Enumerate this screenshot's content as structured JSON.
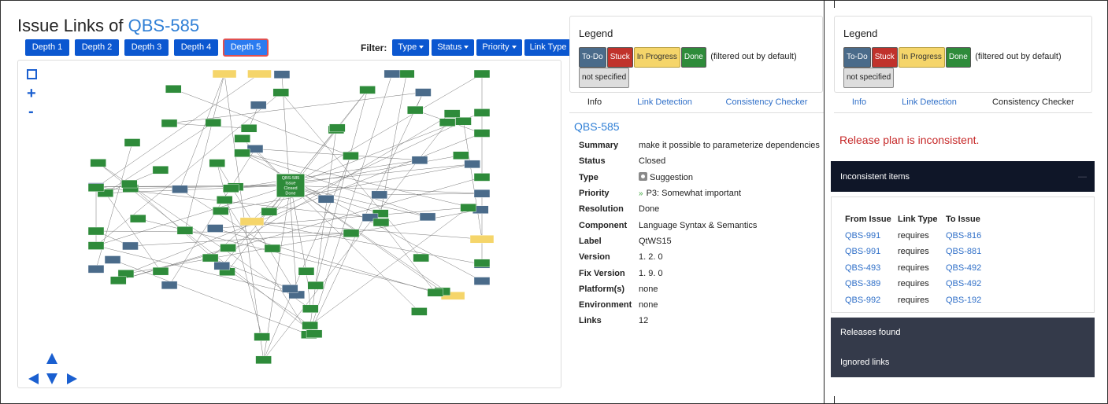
{
  "header": {
    "title_prefix": "Issue Links of ",
    "issue_key": "QBS-585"
  },
  "depth_buttons": [
    "Depth 1",
    "Depth 2",
    "Depth 3",
    "Depth 4",
    "Depth 5"
  ],
  "active_depth": "Depth 5",
  "filter": {
    "label": "Filter:",
    "buttons": [
      "Type",
      "Status",
      "Priority",
      "Link Type"
    ]
  },
  "graph_controls": {
    "plus": "+",
    "minus": "-"
  },
  "graph": {
    "center_node": {
      "key": "QBS-585",
      "type": "Issue",
      "status": "Closed",
      "resolution": "Done"
    }
  },
  "legend": {
    "title": "Legend",
    "chips": {
      "todo": "To-Do",
      "stuck": "Stuck",
      "in_progress": "In Progress",
      "done": "Done",
      "not_specified": "not specified"
    },
    "note": "(filtered out by default)"
  },
  "left_tabs": [
    "Info",
    "Link Detection",
    "Consistency Checker"
  ],
  "right_tabs": [
    "Info",
    "Link Detection",
    "Consistency Checker"
  ],
  "info": {
    "issue_key": "QBS-585",
    "rows": [
      {
        "label": "Summary",
        "value": "make it possible to parameterize dependencies"
      },
      {
        "label": "Status",
        "value": "Closed"
      },
      {
        "label": "Type",
        "value": "Suggestion"
      },
      {
        "label": "Priority",
        "value": "P3: Somewhat important"
      },
      {
        "label": "Resolution",
        "value": "Done"
      },
      {
        "label": "Component",
        "value": "Language Syntax & Semantics"
      },
      {
        "label": "Label",
        "value": "QtWS15"
      },
      {
        "label": "Version",
        "value": "1. 2. 0"
      },
      {
        "label": "Fix Version",
        "value": "1. 9. 0"
      },
      {
        "label": "Platform(s)",
        "value": "none"
      },
      {
        "label": "Environment",
        "value": "none"
      },
      {
        "label": "Links",
        "value": "12"
      }
    ]
  },
  "consistency": {
    "message": "Release plan is inconsistent.",
    "inconsistent_items_label": "Inconsistent items",
    "collapse_icon": "—",
    "table_headers": [
      "From Issue",
      "Link Type",
      "To Issue"
    ],
    "rows": [
      [
        "QBS-991",
        "requires",
        "QBS-816"
      ],
      [
        "QBS-991",
        "requires",
        "QBS-881"
      ],
      [
        "QBS-493",
        "requires",
        "QBS-492"
      ],
      [
        "QBS-389",
        "requires",
        "QBS-492"
      ],
      [
        "QBS-992",
        "requires",
        "QBS-192"
      ]
    ],
    "releases_found_label": "Releases found",
    "ignored_links_label": "Ignored links"
  },
  "colors": {
    "primary": "#0b57d0",
    "link": "#2f6fc8",
    "error": "#c62828",
    "todo": "#4a6b8a",
    "stuck": "#c0322b",
    "in_progress": "#f5d56a",
    "done": "#2e8b3a"
  }
}
